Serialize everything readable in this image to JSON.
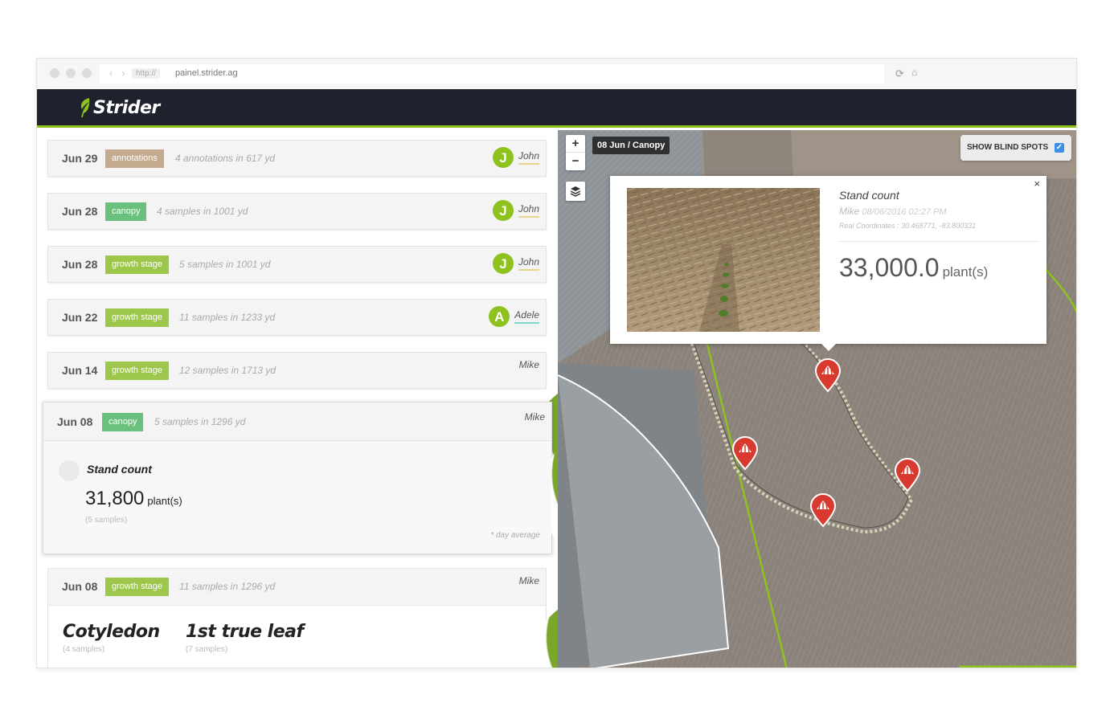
{
  "browser": {
    "protocol": "http://",
    "url": "painel.strider.ag",
    "nav_arrows": "‹ ›",
    "reload_icon": "⟳",
    "home_icon": "⌂"
  },
  "app": {
    "name": "Strider",
    "brand_color": "#8dc21f",
    "header_color": "#1f222d"
  },
  "timeline": [
    {
      "date": "Jun 29",
      "tag": "annotations",
      "summary": "4 annotations in 617 yd",
      "user_initial": "J",
      "user": "John"
    },
    {
      "date": "Jun 28",
      "tag": "canopy",
      "summary": "4 samples in 1001 yd",
      "user_initial": "J",
      "user": "John"
    },
    {
      "date": "Jun 28",
      "tag": "growth stage",
      "summary": "5 samples in 1001 yd",
      "user_initial": "J",
      "user": "John"
    },
    {
      "date": "Jun 22",
      "tag": "growth stage",
      "summary": "11 samples in 1233 yd",
      "user_initial": "A",
      "user": "Adele"
    },
    {
      "date": "Jun 14",
      "tag": "growth stage",
      "summary": "12 samples in 1713 yd",
      "user": "Mike"
    }
  ],
  "expanded": {
    "date": "Jun 08",
    "tag": "canopy",
    "summary": "5 samples in 1296 yd",
    "user": "Mike",
    "metric_title": "Stand count",
    "metric_value": "31,800",
    "metric_unit": "plant(s)",
    "metric_samples": "(5 samples)",
    "footnote": "* day average"
  },
  "growth_card": {
    "date": "Jun 08",
    "tag": "growth stage",
    "summary": "11 samples in 1296 yd",
    "user": "Mike",
    "stages": [
      {
        "name": "Cotyledon",
        "samples": "(4 samples)"
      },
      {
        "name": "1st true leaf",
        "samples": "(7 samples)"
      }
    ]
  },
  "map": {
    "zoom_in": "+",
    "zoom_out": "−",
    "layers_icon": "layers-icon",
    "label": "08 Jun / Canopy",
    "blind_spots_label": "SHOW BLIND SPOTS",
    "blind_spots_checked": true,
    "popup": {
      "close": "×",
      "title": "Stand count",
      "author": "Mike",
      "datetime": "08/06/2016 02:27 PM",
      "coords": "Real Coordinates : 30.468771, -83.800331",
      "value": "33,000.0",
      "unit": "plant(s)"
    }
  }
}
